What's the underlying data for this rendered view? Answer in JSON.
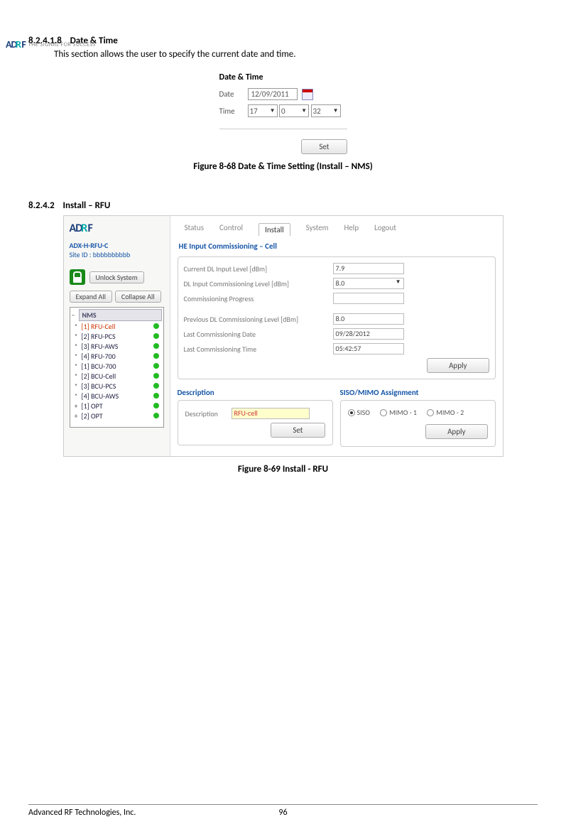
{
  "header": {
    "logo_text": "AD",
    "logo_r": "Я",
    "logo_f": "F",
    "tagline": "THE SIGNAL FOR SUCCESS"
  },
  "s1": {
    "num": "8.2.4.1.8",
    "title": "Date & Time",
    "body": "This section allows the user to specify the current date and time."
  },
  "dt": {
    "heading": "Date & Time",
    "date_label": "Date",
    "date_value": "12/09/2011",
    "time_label": "Time",
    "hh": "17",
    "mm": "0",
    "ss": "32",
    "set_btn": "Set"
  },
  "fig68": "Figure 8-68    Date & Time Setting (Install – NMS)",
  "s2": {
    "num": "8.2.4.2",
    "title": "Install – RFU"
  },
  "rfu": {
    "model": "ADX-H-RFU-C",
    "site": "Site ID : bbbbbbbbbb",
    "unlock_btn": "Unlock System",
    "expand_btn": "Expand All",
    "collapse_btn": "Collapse All",
    "tree_head": "NMS",
    "tree": [
      {
        "p": "*",
        "lbl": "[1] RFU-Cell",
        "sel": true
      },
      {
        "p": "*",
        "lbl": "[2] RFU-PCS",
        "sel": false
      },
      {
        "p": "*",
        "lbl": "[3] RFU-AWS",
        "sel": false
      },
      {
        "p": "*",
        "lbl": "[4] RFU-700",
        "sel": false
      },
      {
        "p": "*",
        "lbl": "[1] BCU-700",
        "sel": false
      },
      {
        "p": "*",
        "lbl": "[2] BCU-Cell",
        "sel": false
      },
      {
        "p": "*",
        "lbl": "[3] BCU-PCS",
        "sel": false
      },
      {
        "p": "*",
        "lbl": "[4] BCU-AWS",
        "sel": false
      },
      {
        "p": "+",
        "lbl": "[1] OPT",
        "sel": false
      },
      {
        "p": "+",
        "lbl": "[2] OPT",
        "sel": false
      }
    ],
    "tabs": {
      "status": "Status",
      "control": "Control",
      "install": "Install",
      "system": "System",
      "help": "Help",
      "logout": "Logout"
    },
    "panel_title": "HE Input Commissioning – Cell",
    "rows": {
      "r1": {
        "label": "Current DL Input Level [dBm]",
        "val": "7.9"
      },
      "r2": {
        "label": "DL Input Commissioning Level [dBm]",
        "val": "8.0"
      },
      "r3": {
        "label": "Commissioning Progress",
        "val": ""
      },
      "r4": {
        "label": "Previous DL Commissioning Level [dBm]",
        "val": "8.0"
      },
      "r5": {
        "label": "Last Commissioning Date",
        "val": "09/28/2012"
      },
      "r6": {
        "label": "Last Commissioning Time",
        "val": "05:42:57"
      }
    },
    "apply_btn": "Apply",
    "desc_title": "Description",
    "desc_label": "Description",
    "desc_value": "RFU-cell",
    "set_btn": "Set",
    "siso_title": "SISO/MIMO Assignment",
    "siso": "SISO",
    "mimo1": "MIMO - 1",
    "mimo2": "MIMO - 2",
    "apply_btn2": "Apply"
  },
  "fig69": "Figure 8-69    Install - RFU",
  "footer": {
    "company": "Advanced RF Technologies, Inc.",
    "page": "96"
  }
}
